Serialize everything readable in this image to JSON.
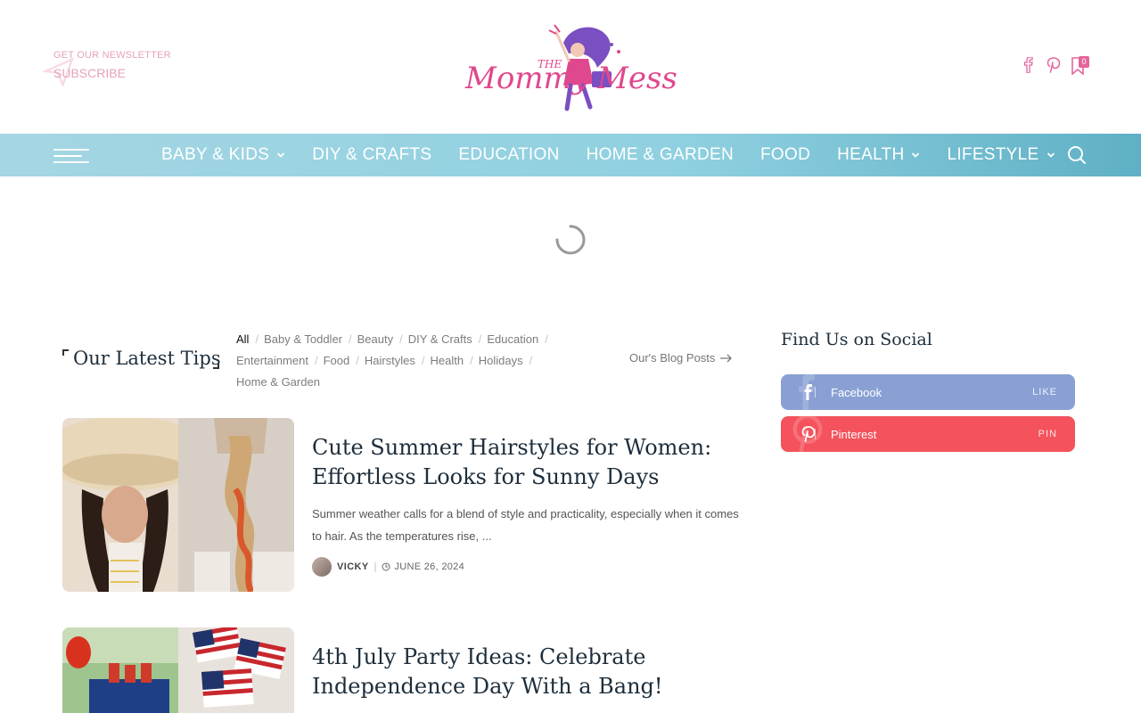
{
  "header": {
    "newsletter_small": "GET OUR NEWSLETTER",
    "newsletter_big": "Subscribe",
    "logo_the": "THE",
    "logo_mommy": "Mommy",
    "logo_mess": "Mess",
    "bookmark_count": "0"
  },
  "nav": {
    "items": [
      {
        "label": "BABY & KIDS",
        "dropdown": true
      },
      {
        "label": "DIY & CRAFTS",
        "dropdown": false
      },
      {
        "label": "EDUCATION",
        "dropdown": false
      },
      {
        "label": "HOME & GARDEN",
        "dropdown": false
      },
      {
        "label": "FOOD",
        "dropdown": false
      },
      {
        "label": "HEALTH",
        "dropdown": true
      },
      {
        "label": "LIFESTYLE",
        "dropdown": true
      }
    ]
  },
  "latest": {
    "title": "Our Latest Tips",
    "filters": [
      "All",
      "Baby & Toddler",
      "Beauty",
      "DIY & Crafts",
      "Education",
      "Entertainment",
      "Food",
      "Hairstyles",
      "Health",
      "Holidays",
      "Home & Garden"
    ],
    "blog_posts_link": "Our's Blog Posts"
  },
  "articles": [
    {
      "title": "Cute Summer Hairstyles for Women: Effortless Looks for Sunny Days",
      "excerpt": "Summer weather calls for a blend of style and practicality, especially when it comes to hair. As the temperatures rise, ...",
      "author": "VICKY",
      "date": "JUNE 26, 2024"
    },
    {
      "title": "4th July Party Ideas: Celebrate Independence Day With a Bang!"
    }
  ],
  "sidebar": {
    "title": "Find Us on Social",
    "socials": [
      {
        "name": "Facebook",
        "action": "LIKE",
        "color": "#8aa0d4"
      },
      {
        "name": "Pinterest",
        "action": "PIN",
        "color": "#f4525c"
      }
    ]
  },
  "colors": {
    "accent_pink": "#e6659b",
    "nav_blue": "#8fd0e0"
  }
}
